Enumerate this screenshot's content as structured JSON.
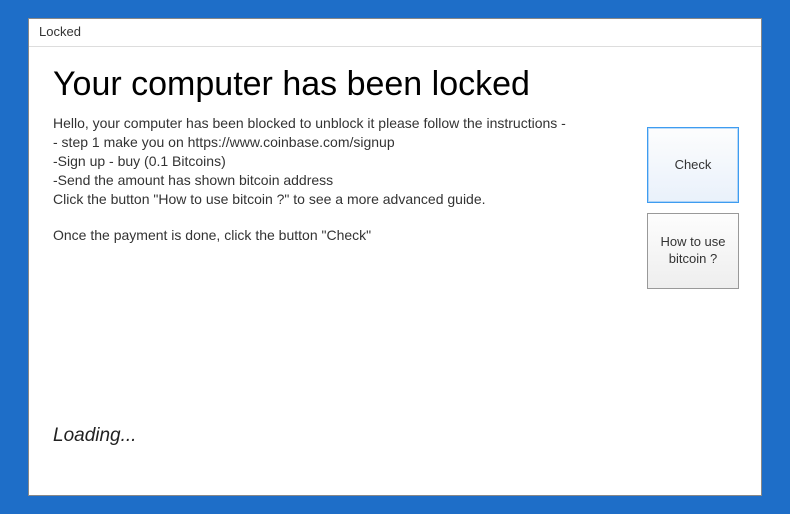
{
  "window": {
    "title": "Locked"
  },
  "heading": "Your computer has been locked",
  "body": {
    "line1": "Hello, your computer has been blocked to unblock it please follow the instructions -",
    "line2": "- step 1 make you on https://www.coinbase.com/signup",
    "line3": "-Sign up - buy (0.1 Bitcoins)",
    "line4": "-Send the amount has shown bitcoin address",
    "line5": "Click the button \"How to use bitcoin ?\" to see a more advanced guide.",
    "line6": "Once the payment is done, click the button \"Check\""
  },
  "buttons": {
    "check": "Check",
    "howto": "How to use bitcoin ?"
  },
  "status": {
    "loading": "Loading..."
  }
}
